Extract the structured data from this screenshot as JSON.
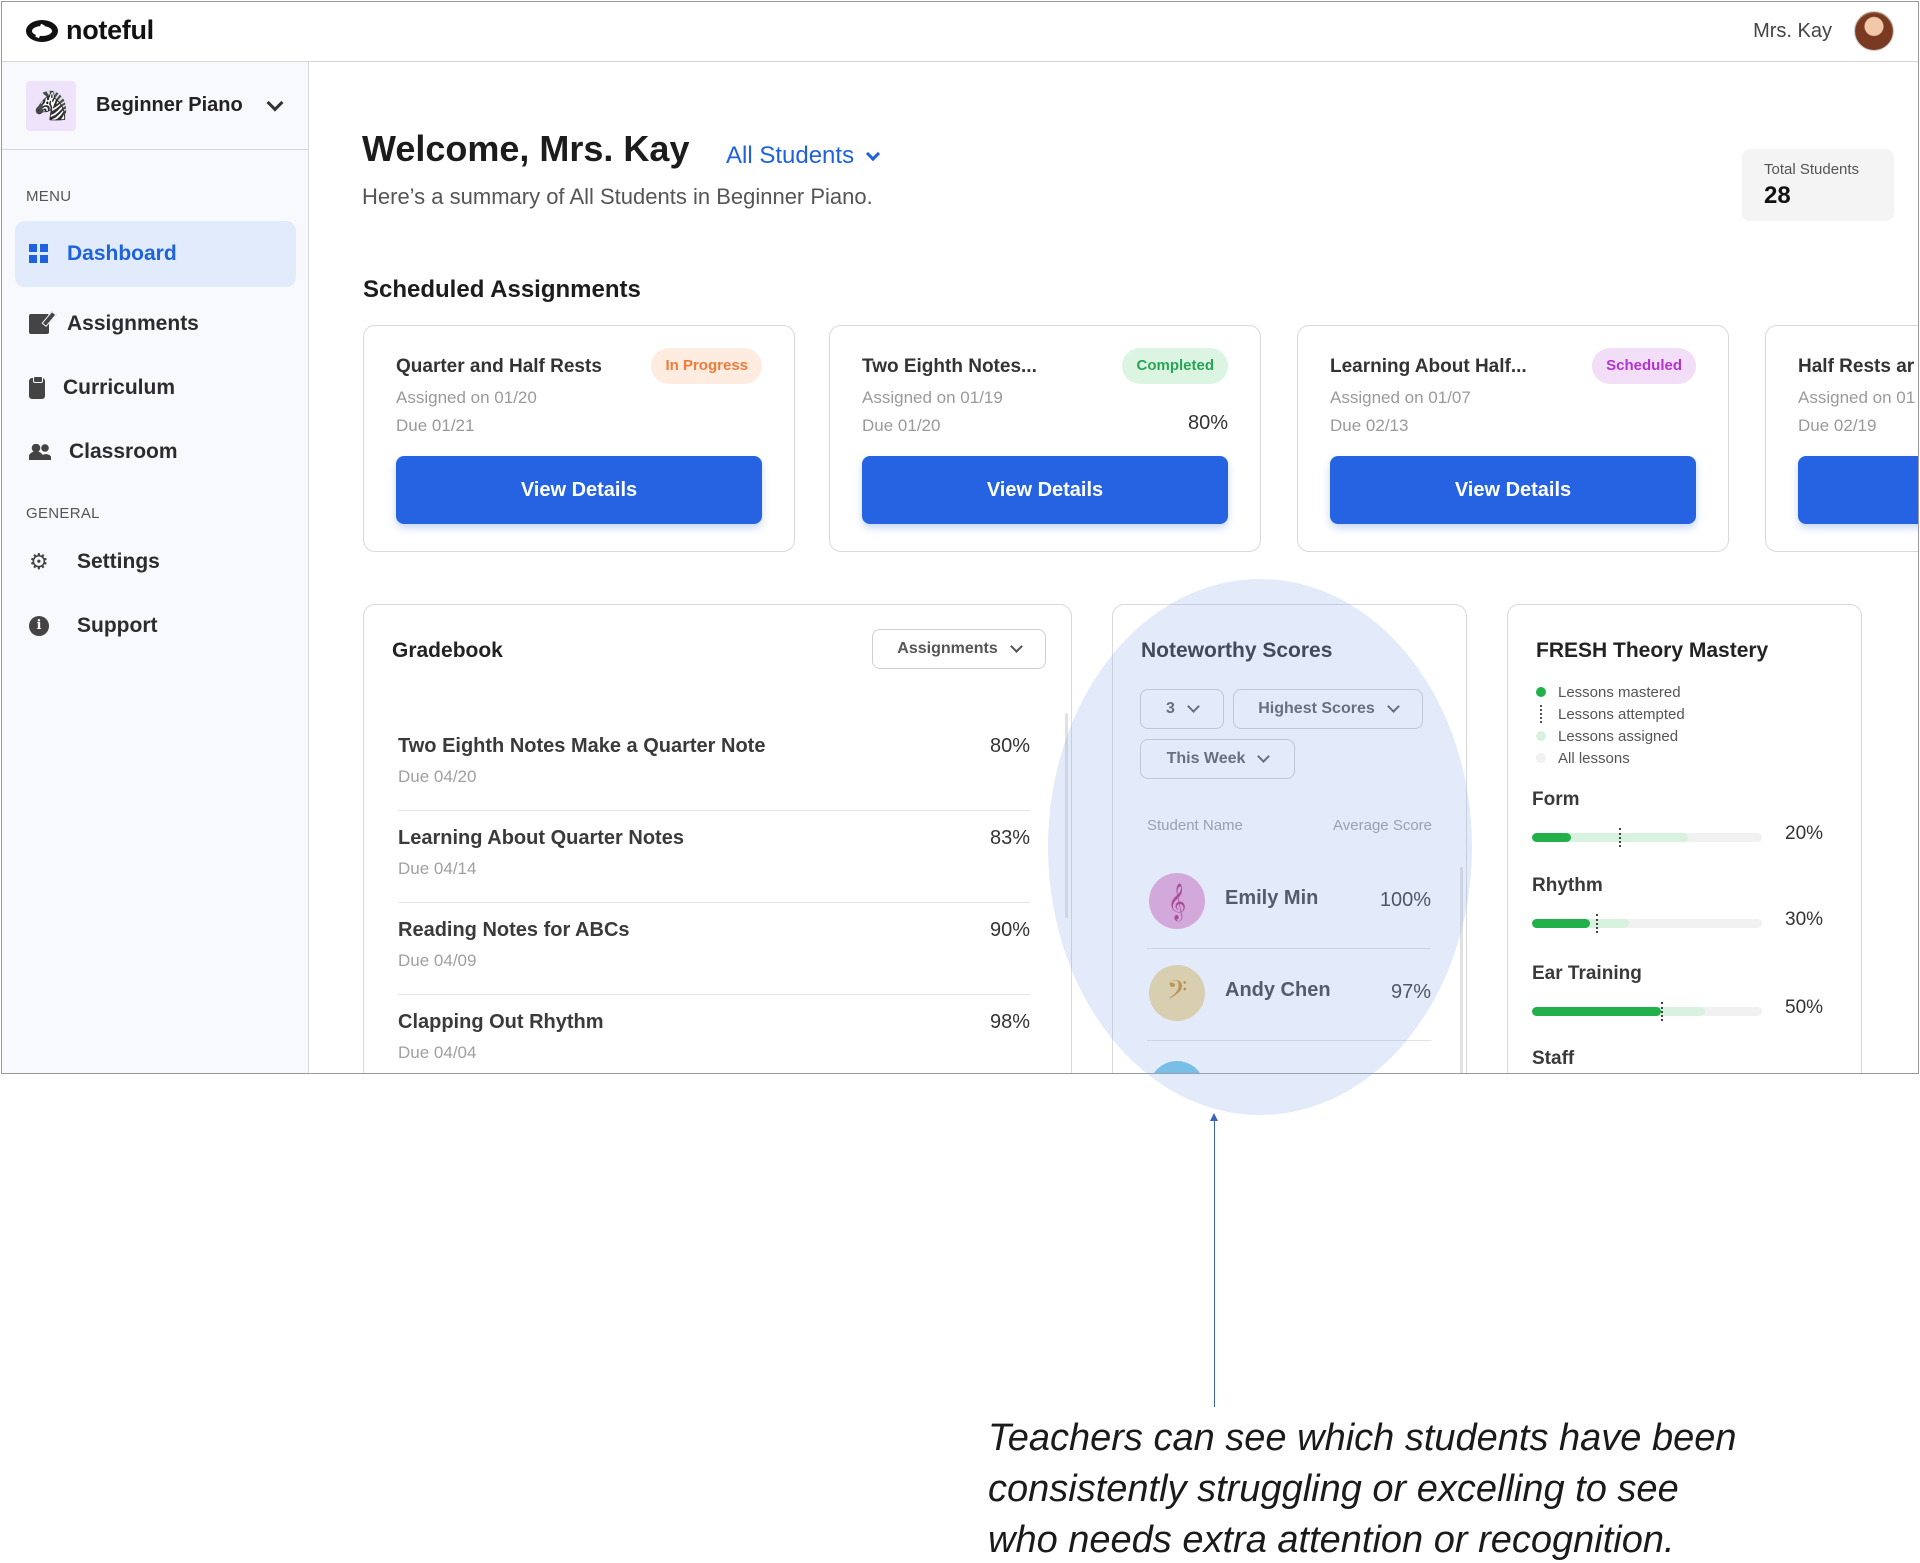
{
  "app": {
    "logo_text": "noteful",
    "user_name": "Mrs. Kay"
  },
  "sidebar": {
    "course_name": "Beginner Piano",
    "menu_label": "MENU",
    "general_label": "GENERAL",
    "items": [
      {
        "label": "Dashboard",
        "icon": "dashboard-icon",
        "active": true
      },
      {
        "label": "Assignments",
        "icon": "edit-icon"
      },
      {
        "label": "Curriculum",
        "icon": "clipboard-icon"
      },
      {
        "label": "Classroom",
        "icon": "people-icon"
      },
      {
        "label": "Settings",
        "icon": "gear-icon"
      },
      {
        "label": "Support",
        "icon": "info-icon"
      }
    ]
  },
  "header": {
    "welcome": "Welcome, Mrs. Kay",
    "filter": "All Students",
    "summary": "Here’s a summary of All Students in Beginner Piano.",
    "total_label": "Total Students",
    "total_value": "28"
  },
  "scheduled": {
    "title": "Scheduled Assignments",
    "button_label": "View Details",
    "cards": [
      {
        "title": "Quarter and Half Rests",
        "status": "In Progress",
        "assigned": "Assigned on 01/20",
        "due": "Due 01/21",
        "score": "",
        "color": "#f07b3a"
      },
      {
        "title": "Two Eighth Notes...",
        "status": "Completed",
        "assigned": "Assigned on 01/19",
        "due": "Due 01/20",
        "score": "80%",
        "color": "#2aa556"
      },
      {
        "title": "Learning About Half...",
        "status": "Scheduled",
        "assigned": "Assigned on 01/07",
        "due": "Due 02/13",
        "score": "",
        "color": "#b334cf"
      },
      {
        "title": "Half Rests ar",
        "status": "",
        "assigned": "Assigned on 01",
        "due": "Due 02/19",
        "score": ""
      }
    ]
  },
  "gradebook": {
    "title": "Gradebook",
    "dropdown": "Assignments",
    "rows": [
      {
        "name": "Two Eighth Notes Make a Quarter Note",
        "due": "Due 04/20",
        "score": "80%"
      },
      {
        "name": "Learning About Quarter Notes",
        "due": "Due 04/14",
        "score": "83%"
      },
      {
        "name": "Reading Notes for ABCs",
        "due": "Due 04/09",
        "score": "90%"
      },
      {
        "name": "Clapping Out Rhythm",
        "due": "Due 04/04",
        "score": "98%"
      }
    ]
  },
  "noteworthy": {
    "title": "Noteworthy Scores",
    "count": "3",
    "sort": "Highest Scores",
    "period": "This Week",
    "col_name": "Student Name",
    "col_score": "Average Score",
    "rows": [
      {
        "name": "Emily Min",
        "score": "100%",
        "icon": "treble-clef-icon",
        "glyph": "𝄞",
        "bg": "#e8a6d4",
        "fg": "#b2247d"
      },
      {
        "name": "Andy Chen",
        "score": "97%",
        "icon": "bass-clef-icon",
        "glyph": "𝄢",
        "bg": "#f0d99a",
        "fg": "#c98a1d"
      }
    ]
  },
  "mastery": {
    "title": "FRESH Theory Mastery",
    "legend": [
      "Lessons mastered",
      "Lessons attempted",
      "Lessons assigned",
      "All lessons"
    ],
    "skills": [
      {
        "name": "Form",
        "pct": "20%",
        "mastered": 0.17,
        "attempted": 0.38,
        "assigned": 0.68
      },
      {
        "name": "Rhythm",
        "pct": "30%",
        "mastered": 0.25,
        "attempted": 0.28,
        "assigned": 0.42
      },
      {
        "name": "Ear Training",
        "pct": "50%",
        "mastered": 0.56,
        "attempted": 0.56,
        "assigned": 0.75
      },
      {
        "name": "Staff",
        "pct": "",
        "mastered": 0,
        "attempted": 0,
        "assigned": 0
      }
    ]
  },
  "annotation": {
    "caption": "Teachers can see which students have been consistently struggling or excelling to see who needs extra attention or recognition."
  }
}
